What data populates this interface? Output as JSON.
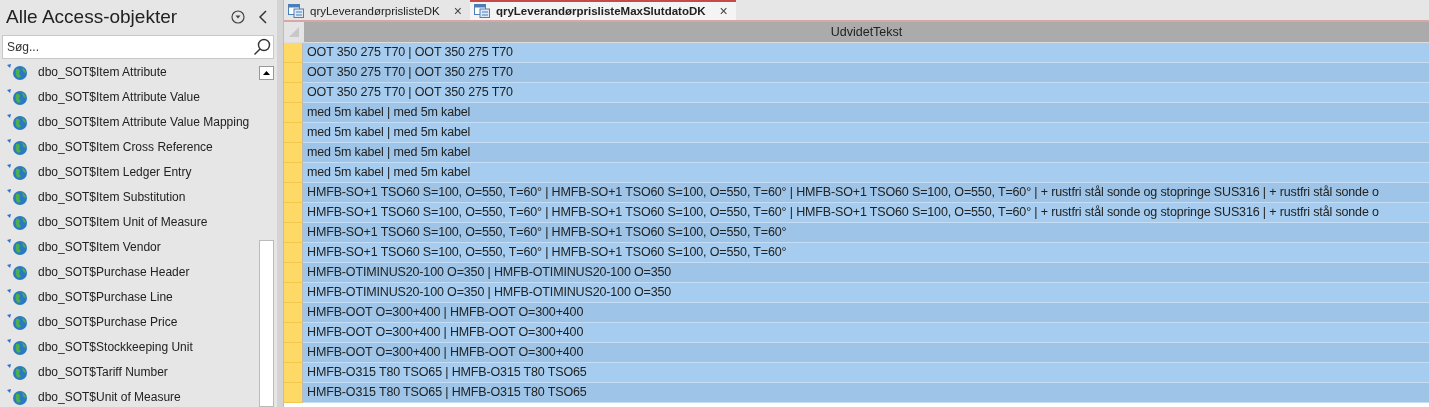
{
  "nav_pane": {
    "title": "Alle Access-objekter",
    "search": {
      "placeholder": "Søg..."
    },
    "items": [
      {
        "name": "dbo_SOT$Item Attribute"
      },
      {
        "name": "dbo_SOT$Item Attribute Value"
      },
      {
        "name": "dbo_SOT$Item Attribute Value Mapping"
      },
      {
        "name": "dbo_SOT$Item Cross Reference"
      },
      {
        "name": "dbo_SOT$Item Ledger Entry"
      },
      {
        "name": "dbo_SOT$Item Substitution"
      },
      {
        "name": "dbo_SOT$Item Unit of Measure"
      },
      {
        "name": "dbo_SOT$Item Vendor"
      },
      {
        "name": "dbo_SOT$Purchase Header"
      },
      {
        "name": "dbo_SOT$Purchase Line"
      },
      {
        "name": "dbo_SOT$Purchase Price"
      },
      {
        "name": "dbo_SOT$Stockkeeping Unit"
      },
      {
        "name": "dbo_SOT$Tariff Number"
      },
      {
        "name": "dbo_SOT$Unit of Measure"
      }
    ]
  },
  "tabs": [
    {
      "label": "qryLeverandørprislisteDK",
      "close": "×",
      "selected": false
    },
    {
      "label": "qryLeverandørprislisteMaxSlutdatoDK",
      "close": "×",
      "selected": true
    }
  ],
  "datasheet": {
    "column": "UdvidetTekst",
    "rows": [
      {
        "text": "OOT 350 275 T70 | OOT 350 275 T70",
        "selected": true
      },
      {
        "text": "OOT 350 275 T70 | OOT 350 275 T70",
        "selected": true
      },
      {
        "text": "OOT 350 275 T70 | OOT 350 275 T70",
        "selected": true
      },
      {
        "text": "med 5m kabel | med 5m kabel",
        "selected": true
      },
      {
        "text": "med 5m kabel | med 5m kabel",
        "selected": true
      },
      {
        "text": "med 5m kabel | med 5m kabel",
        "selected": true
      },
      {
        "text": "med 5m kabel | med 5m kabel",
        "selected": true
      },
      {
        "text": "HMFB-SO+1 TSO60 S=100, O=550, T=60° | HMFB-SO+1 TSO60 S=100, O=550, T=60° | HMFB-SO+1 TSO60 S=100, O=550, T=60° | + rustfri stål sonde og stopringe SUS316 | + rustfri stål sonde o",
        "selected": true
      },
      {
        "text": "HMFB-SO+1 TSO60 S=100, O=550, T=60° | HMFB-SO+1 TSO60 S=100, O=550, T=60° | HMFB-SO+1 TSO60 S=100, O=550, T=60° | + rustfri stål sonde og stopringe SUS316 | + rustfri stål sonde o",
        "selected": true
      },
      {
        "text": "HMFB-SO+1 TSO60 S=100, O=550, T=60° | HMFB-SO+1 TSO60 S=100, O=550, T=60°",
        "selected": true
      },
      {
        "text": "HMFB-SO+1 TSO60 S=100, O=550, T=60° | HMFB-SO+1 TSO60 S=100, O=550, T=60°",
        "selected": true
      },
      {
        "text": "HMFB-OTIMINUS20-100 O=350 | HMFB-OTIMINUS20-100 O=350",
        "selected": true
      },
      {
        "text": "HMFB-OTIMINUS20-100 O=350 | HMFB-OTIMINUS20-100 O=350",
        "selected": true
      },
      {
        "text": "HMFB-OOT O=300+400 | HMFB-OOT O=300+400",
        "selected": true
      },
      {
        "text": "HMFB-OOT O=300+400 | HMFB-OOT O=300+400",
        "selected": true
      },
      {
        "text": "HMFB-OOT O=300+400 | HMFB-OOT O=300+400",
        "selected": true
      },
      {
        "text": "HMFB-O315 T80 TSO65 | HMFB-O315 T80 TSO65",
        "selected": true
      },
      {
        "text": "HMFB-O315 T80 TSO65 | HMFB-O315 T80 TSO65",
        "selected": true
      }
    ]
  }
}
